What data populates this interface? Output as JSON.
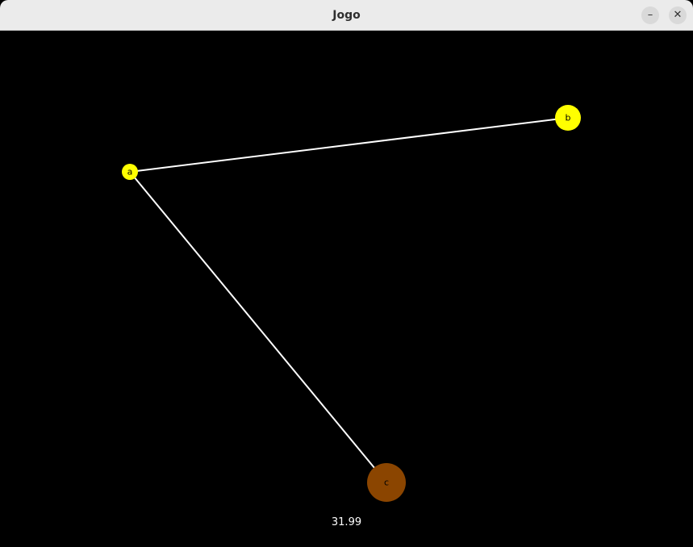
{
  "window": {
    "title": "Jogo",
    "minimize_glyph": "–",
    "close_glyph": "✕"
  },
  "game": {
    "background": "#000000",
    "edge_color": "#ffffff",
    "score": "31.99",
    "nodes": [
      {
        "id": "a",
        "label": "a",
        "color": "#ffff00"
      },
      {
        "id": "b",
        "label": "b",
        "color": "#ffff00"
      },
      {
        "id": "c",
        "label": "c",
        "color": "#8b4500"
      }
    ],
    "edges": [
      {
        "from": "a",
        "to": "b"
      },
      {
        "from": "a",
        "to": "c"
      }
    ]
  }
}
